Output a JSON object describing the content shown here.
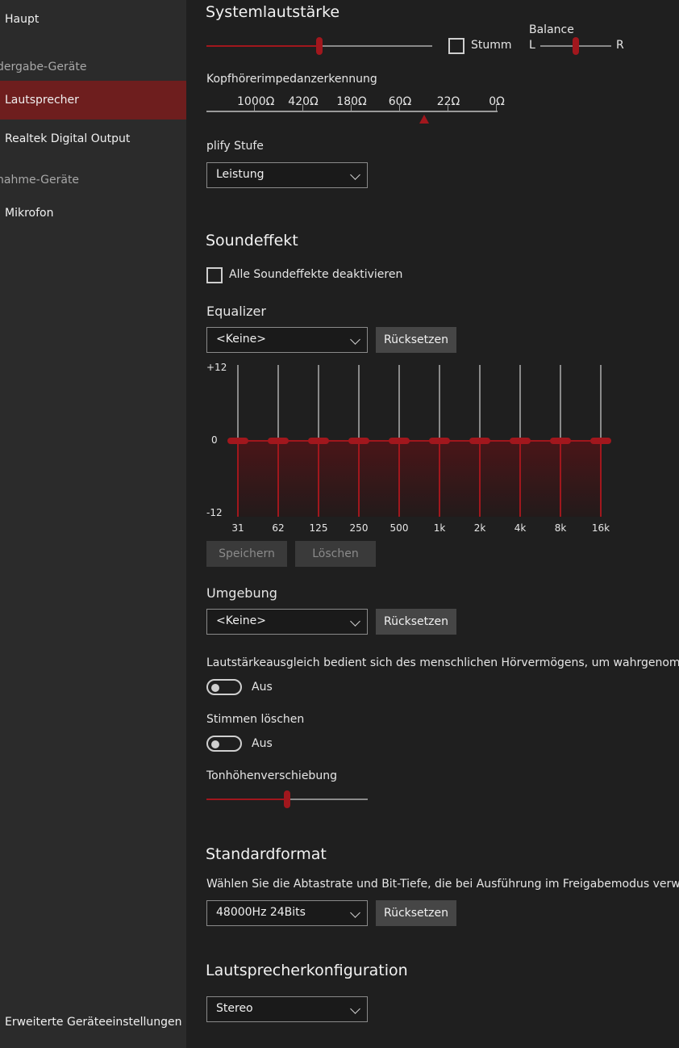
{
  "sidebar": {
    "main": "Haupt",
    "playback_category": "dergabe-Geräte",
    "playback_devices": [
      "Lautsprecher",
      "Realtek Digital Output"
    ],
    "recording_category": "nahme-Geräte",
    "recording_devices": [
      "Mikrofon"
    ],
    "advanced_settings": "Erweiterte Geräteeinstellungen"
  },
  "system_volume": {
    "title": "Systemlautstärke",
    "level_percent": 50,
    "mute_label": "Stumm",
    "mute_checked": false,
    "balance_label": "Balance",
    "balance_left": "L",
    "balance_right": "R",
    "balance_level_percent": 50
  },
  "impedance": {
    "title": "Kopfhörerimpedanzerkennung",
    "ticks": [
      "1000Ω",
      "420Ω",
      "180Ω",
      "60Ω",
      "22Ω",
      "0Ω"
    ]
  },
  "amplify": {
    "title": "plify Stufe",
    "selected": "Leistung"
  },
  "sound_effect": {
    "title": "Soundeffekt",
    "disable_all_label": "Alle Soundeffekte deaktivieren",
    "disable_all_checked": false
  },
  "equalizer": {
    "title": "Equalizer",
    "preset": "<Keine>",
    "reset_label": "Rücksetzen",
    "y_max_label": "+12",
    "y_zero_label": "0",
    "y_min_label": "-12",
    "bands": [
      "31",
      "62",
      "125",
      "250",
      "500",
      "1k",
      "2k",
      "4k",
      "8k",
      "16k"
    ],
    "gains_db": [
      0,
      0,
      0,
      0,
      0,
      0,
      0,
      0,
      0,
      0
    ],
    "save_label": "Speichern",
    "delete_label": "Löschen"
  },
  "environment": {
    "title": "Umgebung",
    "selected": "<Keine>",
    "reset_label": "Rücksetzen"
  },
  "loudness": {
    "description": "Lautstärkeausgleich bedient sich des menschlichen Hörvermögens, um wahrgenommene",
    "state": "Aus"
  },
  "voice_cancel": {
    "title": "Stimmen löschen",
    "state": "Aus"
  },
  "pitch": {
    "title": "Tonhöhenverschiebung",
    "level_percent": 50
  },
  "default_format": {
    "title": "Standardformat",
    "description": "Wählen Sie die Abtastrate und Bit-Tiefe, die bei Ausführung im Freigabemodus verwende",
    "selected": "48000Hz 24Bits",
    "reset_label": "Rücksetzen"
  },
  "speaker_config": {
    "title": "Lautsprecherkonfiguration",
    "selected": "Stereo"
  },
  "colors": {
    "accent": "#a1171d",
    "sidebar_bg": "#2b2b2b",
    "sidebar_active": "#6e1e1e",
    "content_bg": "#1f1f1f"
  }
}
